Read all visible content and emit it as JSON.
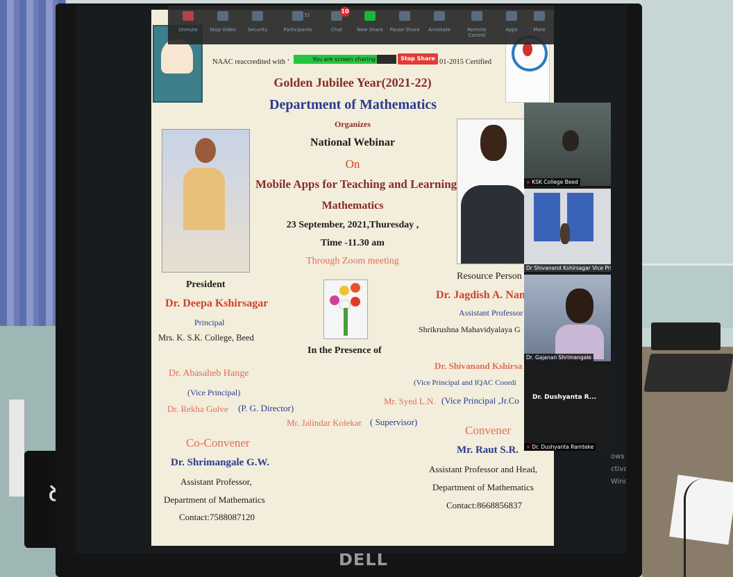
{
  "zoom_toolbar": {
    "items": [
      {
        "label": "Unmute",
        "icon": "mic-off-icon"
      },
      {
        "label": "Stop Video",
        "icon": "video-icon"
      },
      {
        "label": "Security",
        "icon": "shield-icon"
      },
      {
        "label": "Participants",
        "icon": "participants-icon",
        "count": "31"
      },
      {
        "label": "Chat",
        "icon": "chat-icon",
        "badge": "10"
      },
      {
        "label": "New Share",
        "icon": "share-icon"
      },
      {
        "label": "Pause Share",
        "icon": "pause-icon"
      },
      {
        "label": "Annotate",
        "icon": "pen-icon"
      },
      {
        "label": "Remote Control",
        "icon": "mouse-icon"
      },
      {
        "label": "Apps",
        "icon": "apps-icon"
      },
      {
        "label": "More",
        "icon": "more-icon"
      }
    ],
    "sharing_text": "You are screen sharing",
    "stop_share": "Stop Share"
  },
  "poster": {
    "naac_left": "NAAC reaccredited with ‘",
    "naac_right": "01-2015 Certified",
    "jubilee": "Golden Jubilee Year(2021-22)",
    "department": "Department of  Mathematics",
    "organizes": "Organizes",
    "webinar": "National Webinar",
    "on": "On",
    "topic_line1": "Mobile Apps for Teaching and Learning",
    "topic_line2": "Mathematics",
    "date": "23 September, 2021,Thuresday ,",
    "time": "Time -11.30 am",
    "medium": "Through Zoom meeting",
    "president_label": "President",
    "president_name": "Dr. Deepa Kshirsagar",
    "president_role": "Principal",
    "president_college": "Mrs. K. S.K. College, Beed",
    "resource_label": "Resource Person",
    "resource_name": "Dr. Jagdish A. Nanav",
    "resource_role": "Assistant Professor",
    "resource_college": "Shrikrushna Mahavidyalaya G",
    "presence_label": "In the Presence of",
    "vp1_name": "Dr.  Abasaheb Hange",
    "vp1_role": "(Vice Principal)",
    "pg_name": "Dr. Rekha Gulve",
    "pg_role": "(P. G. Director)",
    "supervisor_name": "Mr. Jalindar Kolekar",
    "supervisor_role": "( Supervisor)",
    "iqac_name": "Dr. Shivanand  Kshirsa",
    "iqac_role": "(Vice Principal and IQAC Coordi",
    "jr_name": "Mr.  Syed L.N.",
    "jr_role": "(Vice Principal ,Jr.Co",
    "coconvener_label": "Co-Convener",
    "coconvener_name": "Dr. Shrimangale G.W.",
    "coconvener_role": "Assistant Professor,",
    "coconvener_dept": "Department of Mathematics",
    "coconvener_contact": "Contact:7588087120",
    "convener_label": "Convener",
    "convener_name": "Mr. Raut S.R.",
    "convener_role": "Assistant Professor and Head,",
    "convener_dept": "Department of Mathematics",
    "convener_contact": "Contact:8668856837"
  },
  "participants": [
    {
      "name": "KSK College Beed"
    },
    {
      "name": "Dr Shivanand Kshirsagar Vice Princi..."
    },
    {
      "name": "Dr. Gajanan Shrimangale"
    },
    {
      "name": "Dr. Dushyanta Ramteke",
      "display": "Dr. Dushyanta R..."
    }
  ],
  "watermark": {
    "line1": "ows",
    "line2": "ctivate Windows."
  },
  "monitor_brand": "DELL"
}
